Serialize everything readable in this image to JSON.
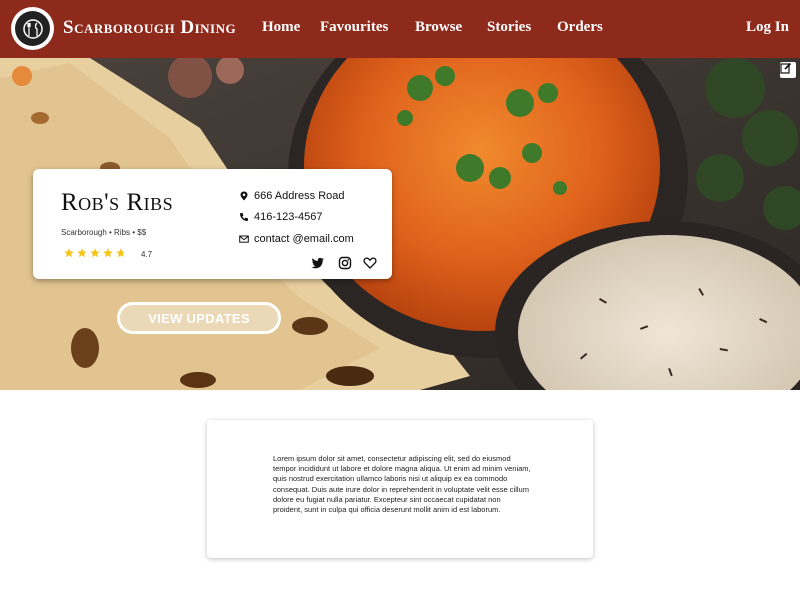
{
  "brand": "Scarborough Dining",
  "nav": {
    "home": "Home",
    "favourites": "Favourites",
    "browse": "Browse",
    "stories": "Stories",
    "orders": "Orders",
    "login": "Log In"
  },
  "restaurant": {
    "name": "Rob's Ribs",
    "meta": "Scarborough • Ribs • $$",
    "rating": "4.7",
    "rating_value": 4.7,
    "address": "666 Address Road",
    "phone": "416-123-4567",
    "email": "contact @email.com"
  },
  "view_updates_label": "VIEW UPDATES",
  "description": "Lorem ipsum dolor sit amet, consectetur adipiscing elit, sed do eiusmod tempor incididunt ut labore et dolore magna aliqua. Ut enim ad minim veniam, quis nostrud exercitation ullamco laboris nisi ut aliquip ex ea commodo consequat. Duis aute irure dolor in reprehenderit in voluptate velit esse cillum dolore eu fugiat nulla pariatur. Excepteur sint occaecat cupidatat non proident, sunt in culpa qui officia deserunt mollit anim id est laborum.",
  "icons": [
    "logo-icon",
    "edit-icon",
    "map-pin-icon",
    "phone-icon",
    "mail-icon",
    "twitter-icon",
    "instagram-icon",
    "heart-icon",
    "star-icon"
  ],
  "colors": {
    "navbar": "#8e2a1c",
    "star": "#f5c518"
  }
}
